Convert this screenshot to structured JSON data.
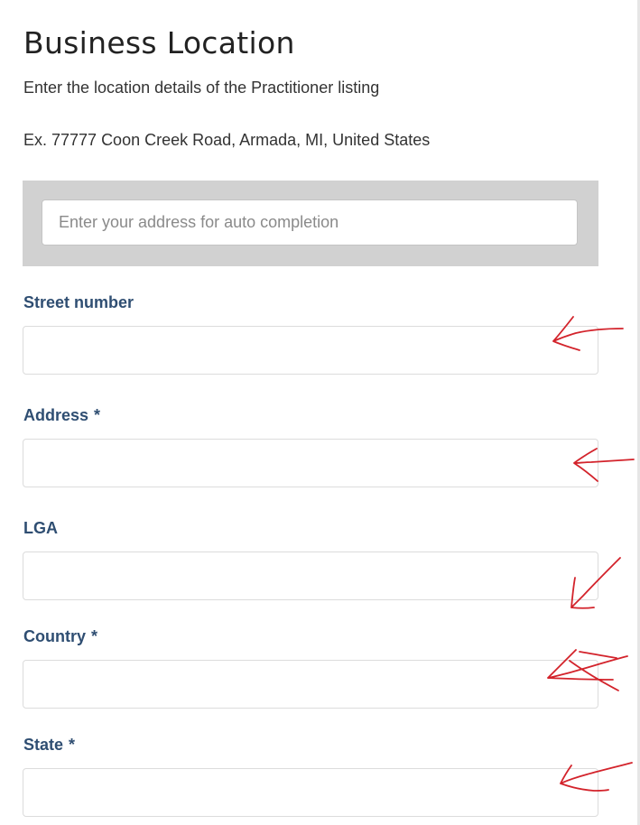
{
  "page": {
    "title": "Business Location",
    "subtitle": "Enter the location details of the Practitioner listing",
    "example": "Ex. 77777 Coon Creek Road, Armada, MI, United States"
  },
  "autocomplete": {
    "placeholder": "Enter your address for auto completion",
    "value": ""
  },
  "fields": [
    {
      "label": "Street number",
      "required": false,
      "required_mark": "",
      "value": ""
    },
    {
      "label": "Address",
      "required": true,
      "required_mark": "*",
      "value": ""
    },
    {
      "label": "LGA",
      "required": false,
      "required_mark": "",
      "value": ""
    },
    {
      "label": "Country",
      "required": true,
      "required_mark": "*",
      "value": ""
    },
    {
      "label": "State",
      "required": true,
      "required_mark": "*",
      "value": ""
    }
  ],
  "colors": {
    "label": "#2f4e72",
    "panel": "#d1d1d1",
    "annotation": "#d3232b"
  },
  "annotations": {
    "type": "hand-drawn red arrows pointing at input fields",
    "count": 5
  }
}
